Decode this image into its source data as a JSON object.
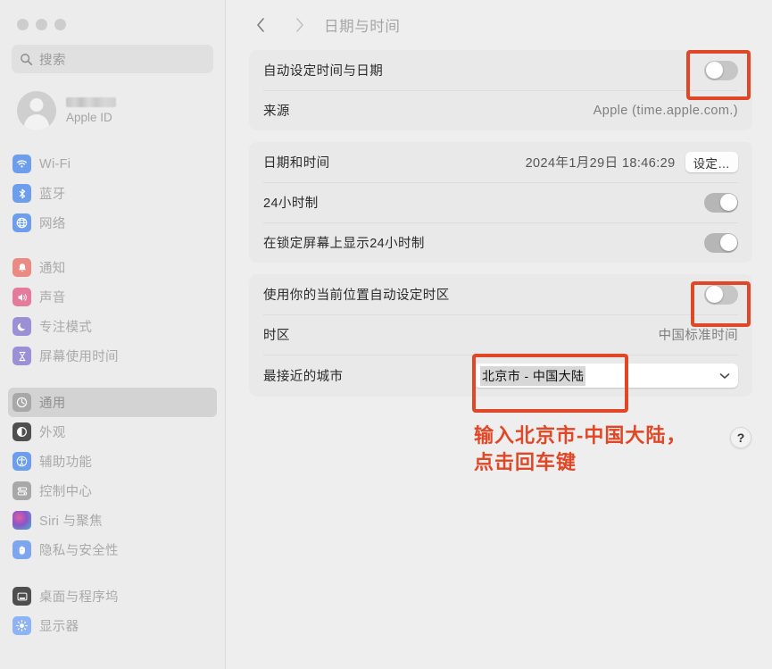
{
  "window": {
    "traffic_lights": [
      "close",
      "minimize",
      "zoom"
    ]
  },
  "sidebar": {
    "search": {
      "placeholder": "搜索",
      "icon": "search-icon"
    },
    "account": {
      "name_redacted": "",
      "subtitle": "Apple ID",
      "avatar_icon": "person-avatar-icon"
    },
    "groups": [
      {
        "items": [
          {
            "label": "Wi-Fi",
            "icon": "wifi-icon",
            "color": "#6d9eeb",
            "selected": false
          },
          {
            "label": "蓝牙",
            "icon": "bluetooth-icon",
            "color": "#6d9eeb",
            "selected": false
          },
          {
            "label": "网络",
            "icon": "globe-icon",
            "color": "#6d9eeb",
            "selected": false
          }
        ]
      },
      {
        "items": [
          {
            "label": "通知",
            "icon": "bell-icon",
            "color": "#e98b82",
            "selected": false
          },
          {
            "label": "声音",
            "icon": "speaker-icon",
            "color": "#e47b9c",
            "selected": false
          },
          {
            "label": "专注模式",
            "icon": "moon-icon",
            "color": "#9b8fd6",
            "selected": false
          },
          {
            "label": "屏幕使用时间",
            "icon": "hourglass-icon",
            "color": "#9b8fd6",
            "selected": false
          }
        ]
      },
      {
        "items": [
          {
            "label": "通用",
            "icon": "gear-icon",
            "color": "#a8a8a8",
            "selected": true
          },
          {
            "label": "外观",
            "icon": "appearance-icon",
            "color": "#4f4f4f",
            "selected": false
          },
          {
            "label": "辅助功能",
            "icon": "accessibility-icon",
            "color": "#6d9eeb",
            "selected": false
          },
          {
            "label": "控制中心",
            "icon": "control-center-icon",
            "color": "#a8a8a8",
            "selected": false
          },
          {
            "label": "Siri 与聚焦",
            "icon": "siri-icon",
            "color": "#8a6f9e",
            "selected": false
          },
          {
            "label": "隐私与安全性",
            "icon": "hand-privacy-icon",
            "color": "#7ea6ef",
            "selected": false
          }
        ]
      },
      {
        "items": [
          {
            "label": "桌面与程序坞",
            "icon": "desktop-dock-icon",
            "color": "#4f4f4f",
            "selected": false
          },
          {
            "label": "显示器",
            "icon": "display-brightness-icon",
            "color": "#8fb4f5",
            "selected": false
          }
        ]
      }
    ]
  },
  "toolbar": {
    "back_icon": "chevron-left-icon",
    "forward_icon": "chevron-right-icon",
    "title": "日期与时间"
  },
  "cards": [
    {
      "id": "auto-time-card",
      "rows": [
        {
          "type": "toggle",
          "label": "自动设定时间与日期",
          "state": "off"
        },
        {
          "type": "value",
          "label": "来源",
          "value": "Apple (time.apple.com.)"
        }
      ]
    },
    {
      "id": "datetime-card",
      "rows": [
        {
          "type": "value-button",
          "label": "日期和时间",
          "value": "2024年1月29日 18:46:29",
          "button": "设定…"
        },
        {
          "type": "toggle",
          "label": "24小时制",
          "state": "on"
        },
        {
          "type": "toggle",
          "label": "在锁定屏幕上显示24小时制",
          "state": "on"
        }
      ]
    },
    {
      "id": "timezone-card",
      "rows": [
        {
          "type": "toggle",
          "label": "使用你的当前位置自动设定时区",
          "state": "off"
        },
        {
          "type": "value",
          "label": "时区",
          "value": "中国标准时间"
        },
        {
          "type": "combo",
          "label": "最接近的城市",
          "value": "北京市 - 中国大陆",
          "arrow_icon": "chevron-down-icon"
        }
      ]
    }
  ],
  "annotations": {
    "color": "#e04726",
    "boxes": [
      {
        "name": "highlight-auto-time-toggle"
      },
      {
        "name": "highlight-auto-timezone-toggle"
      },
      {
        "name": "highlight-closest-city-combo"
      }
    ],
    "instruction_line1": "输入北京市-中国大陆，",
    "instruction_line2": "点击回车键",
    "help_button": "?"
  }
}
